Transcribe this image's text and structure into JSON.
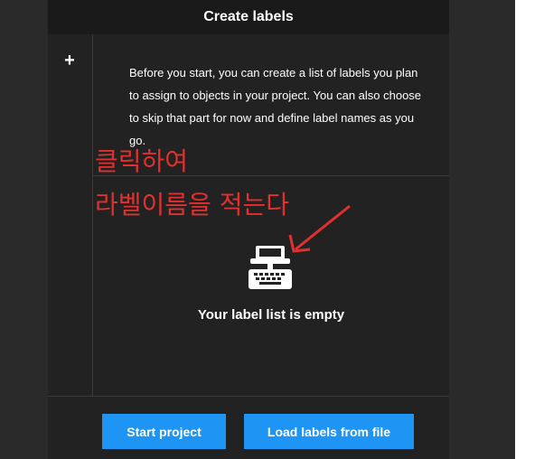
{
  "header": {
    "title": "Create labels"
  },
  "sidebar": {
    "add_symbol": "+"
  },
  "intro": {
    "text": "Before you start, you can create a list of labels you plan to assign to objects in your project. You can also choose to skip that part for now and define label names as you go."
  },
  "empty_state": {
    "icon": "typewriter-icon",
    "text": "Your label list is empty"
  },
  "buttons": {
    "start_label": "Start project",
    "load_label": "Load labels from file"
  },
  "annotation": {
    "line1": "클릭하여",
    "line2": "라벨이름을 적는다",
    "color": "#e03030"
  },
  "colors": {
    "accent": "#1e95f5",
    "panel": "#222222",
    "header": "#1a1a1a"
  }
}
